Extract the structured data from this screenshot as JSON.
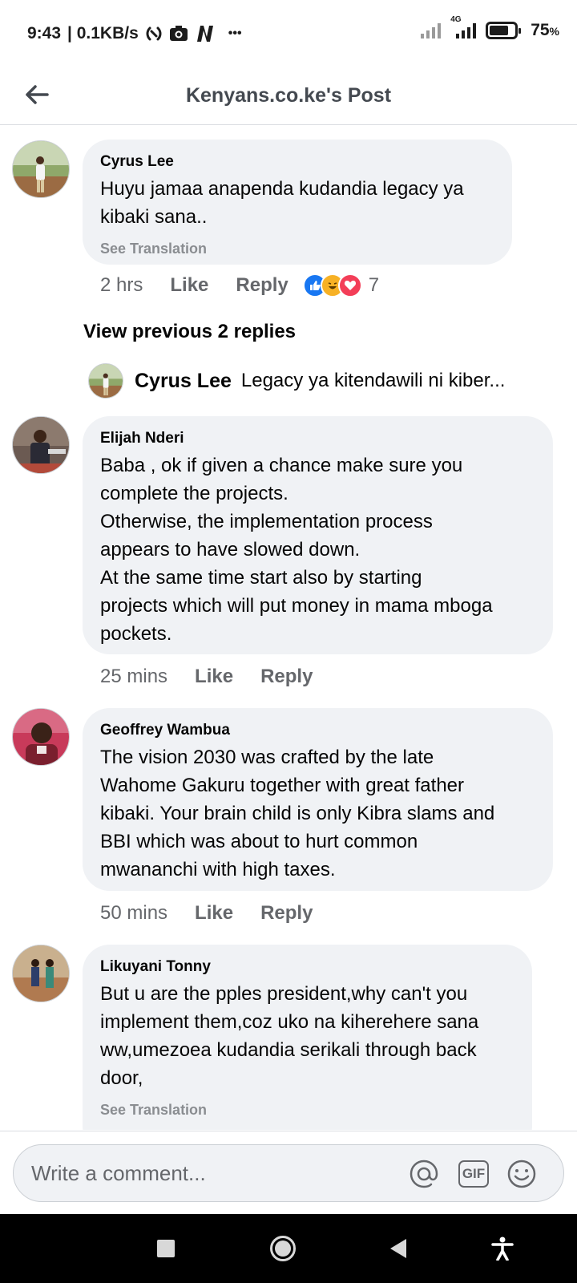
{
  "status_bar": {
    "time": "9:43",
    "speed": "| 0.1KB/s",
    "more": "•••",
    "network": "4G",
    "battery": "75",
    "battery_unit": "%",
    "battery_level": 0.75
  },
  "header": {
    "title": "Kenyans.co.ke's Post"
  },
  "comments": [
    {
      "author": "Cyrus Lee",
      "text": "Huyu jamaa anapenda kudandia legacy ya\nkibaki sana..",
      "see_translation": "See Translation",
      "time": "2 hrs",
      "like": "Like",
      "reply": "Reply",
      "reaction_count": "7"
    },
    {
      "author": "Elijah Nderi",
      "text": "Baba , ok if given a chance make sure you\ncomplete the projects.\nOtherwise, the implementation process\nappears to have slowed down.\nAt the same time start also by starting\nprojects which will put money in mama mboga\npockets.",
      "time": "25 mins",
      "like": "Like",
      "reply": "Reply"
    },
    {
      "author": "Geoffrey Wambua",
      "text": "The vision 2030 was crafted by the late\nWahome Gakuru together with great father\nkibaki. Your brain child is only Kibra slams and\nBBI which was about to hurt common\nmwananchi with high taxes.",
      "time": "50 mins",
      "like": "Like",
      "reply": "Reply"
    },
    {
      "author": "Likuyani Tonny",
      "text": "But u are the pples president,why can't you\nimplement them,coz uko na kiherehere sana\nww,umezoea kudandia serikali through back\ndoor,",
      "see_translation": "See Translation"
    }
  ],
  "replies": {
    "view_previous": "View previous 2 replies",
    "latest_author": "Cyrus Lee",
    "latest_text": "Legacy ya kitendawili ni kiber..."
  },
  "composer": {
    "placeholder": "Write a comment...",
    "gif_label": "GIF"
  },
  "colors": {
    "bubble": "#f0f2f5",
    "secondary_text": "#65676b",
    "like_blue": "#1877f2",
    "haha_yellow": "#f7b125",
    "love_red": "#f33e58"
  }
}
